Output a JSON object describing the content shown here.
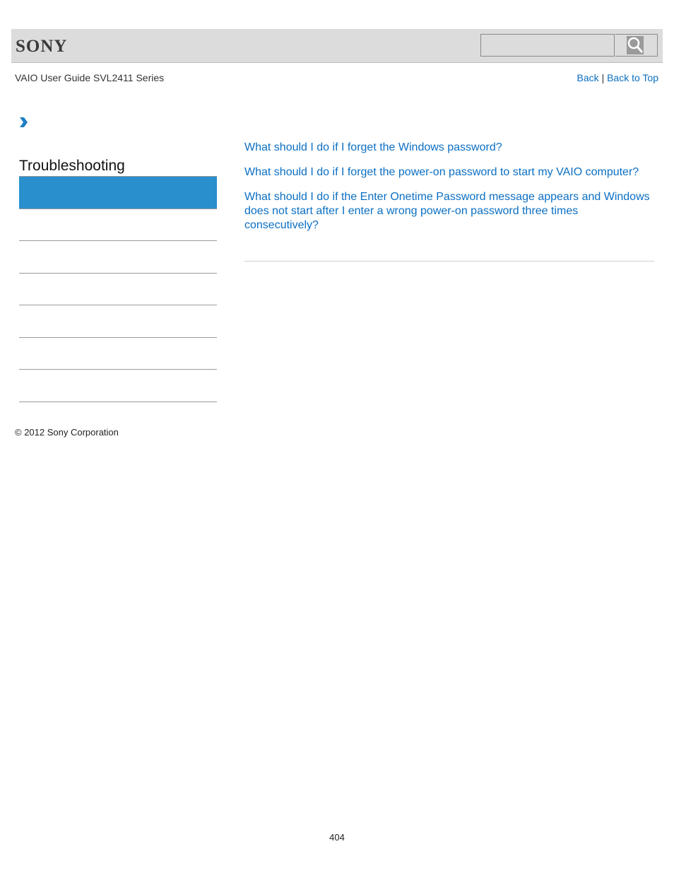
{
  "header": {
    "brand": "SONY",
    "search": {
      "placeholder": "",
      "value": ""
    },
    "search_button_icon": "magnifier-icon"
  },
  "guide_title": "VAIO User Guide SVL2411 Series",
  "nav_links": {
    "back": "Back",
    "separator": "|",
    "back_to_top": "Back to Top"
  },
  "breadcrumb_icon": "chevron-right-icon",
  "sidebar": {
    "title": "Troubleshooting",
    "items": [
      "",
      "",
      "",
      "",
      "",
      "",
      ""
    ]
  },
  "main": {
    "links": [
      "What should I do if I forget the Windows password?",
      "What should I do if I forget the power-on password to start my VAIO computer?",
      "What should I do if the Enter Onetime Password message appears and Windows does not start after I enter a wrong power-on password three times consecutively?"
    ]
  },
  "footer": {
    "copyright": "© 2012 Sony Corporation",
    "page_number": "404"
  },
  "colors": {
    "accent": "#2a8fcd",
    "link": "#0b6fc3",
    "header_bg": "#dcdcdc"
  }
}
